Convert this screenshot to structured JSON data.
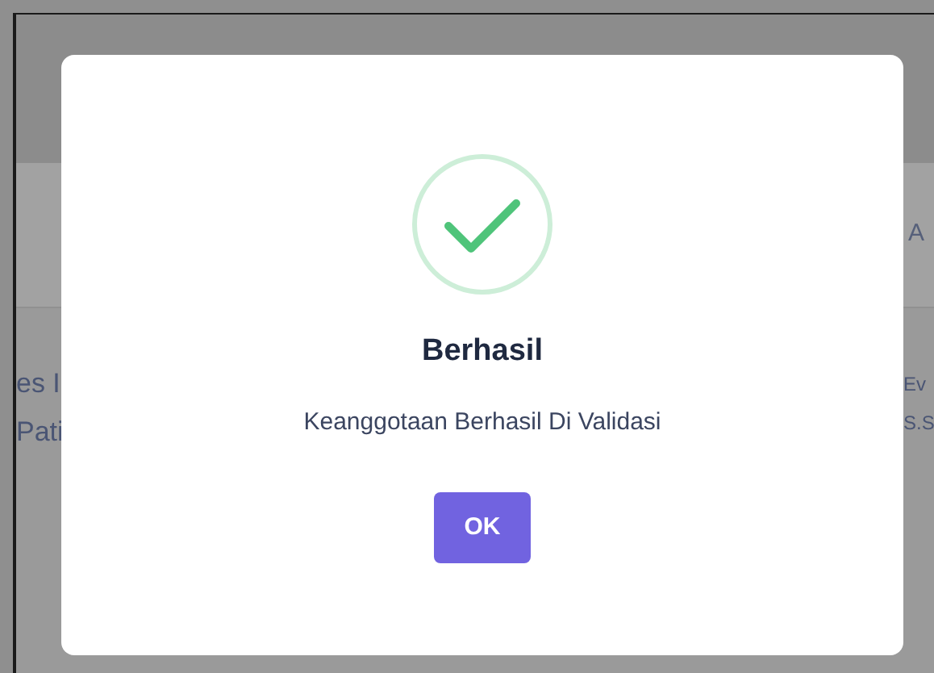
{
  "background": {
    "left_fragments": [
      "es I",
      "Pati"
    ],
    "right_fragments": [
      "A",
      "Ev",
      "S.S"
    ]
  },
  "dialog": {
    "title": "Berhasil",
    "message": "Keanggotaan Berhasil Di Validasi",
    "button": "OK"
  }
}
